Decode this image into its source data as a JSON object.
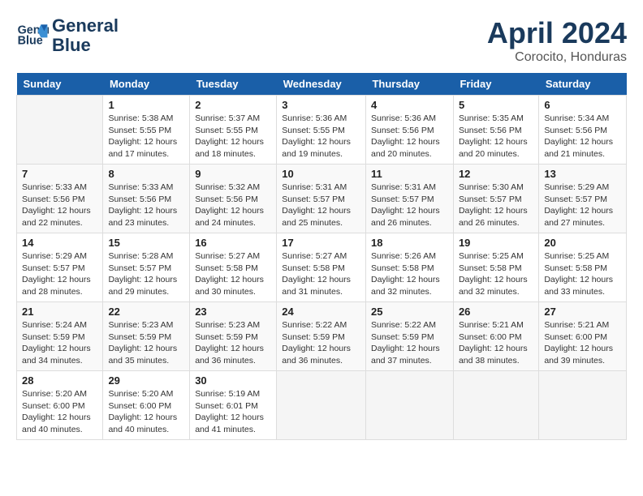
{
  "header": {
    "logo_line1": "General",
    "logo_line2": "Blue",
    "month": "April 2024",
    "location": "Corocito, Honduras"
  },
  "days_of_week": [
    "Sunday",
    "Monday",
    "Tuesday",
    "Wednesday",
    "Thursday",
    "Friday",
    "Saturday"
  ],
  "weeks": [
    [
      {
        "day": "",
        "info": ""
      },
      {
        "day": "1",
        "info": "Sunrise: 5:38 AM\nSunset: 5:55 PM\nDaylight: 12 hours\nand 17 minutes."
      },
      {
        "day": "2",
        "info": "Sunrise: 5:37 AM\nSunset: 5:55 PM\nDaylight: 12 hours\nand 18 minutes."
      },
      {
        "day": "3",
        "info": "Sunrise: 5:36 AM\nSunset: 5:55 PM\nDaylight: 12 hours\nand 19 minutes."
      },
      {
        "day": "4",
        "info": "Sunrise: 5:36 AM\nSunset: 5:56 PM\nDaylight: 12 hours\nand 20 minutes."
      },
      {
        "day": "5",
        "info": "Sunrise: 5:35 AM\nSunset: 5:56 PM\nDaylight: 12 hours\nand 20 minutes."
      },
      {
        "day": "6",
        "info": "Sunrise: 5:34 AM\nSunset: 5:56 PM\nDaylight: 12 hours\nand 21 minutes."
      }
    ],
    [
      {
        "day": "7",
        "info": "Sunrise: 5:33 AM\nSunset: 5:56 PM\nDaylight: 12 hours\nand 22 minutes."
      },
      {
        "day": "8",
        "info": "Sunrise: 5:33 AM\nSunset: 5:56 PM\nDaylight: 12 hours\nand 23 minutes."
      },
      {
        "day": "9",
        "info": "Sunrise: 5:32 AM\nSunset: 5:56 PM\nDaylight: 12 hours\nand 24 minutes."
      },
      {
        "day": "10",
        "info": "Sunrise: 5:31 AM\nSunset: 5:57 PM\nDaylight: 12 hours\nand 25 minutes."
      },
      {
        "day": "11",
        "info": "Sunrise: 5:31 AM\nSunset: 5:57 PM\nDaylight: 12 hours\nand 26 minutes."
      },
      {
        "day": "12",
        "info": "Sunrise: 5:30 AM\nSunset: 5:57 PM\nDaylight: 12 hours\nand 26 minutes."
      },
      {
        "day": "13",
        "info": "Sunrise: 5:29 AM\nSunset: 5:57 PM\nDaylight: 12 hours\nand 27 minutes."
      }
    ],
    [
      {
        "day": "14",
        "info": "Sunrise: 5:29 AM\nSunset: 5:57 PM\nDaylight: 12 hours\nand 28 minutes."
      },
      {
        "day": "15",
        "info": "Sunrise: 5:28 AM\nSunset: 5:57 PM\nDaylight: 12 hours\nand 29 minutes."
      },
      {
        "day": "16",
        "info": "Sunrise: 5:27 AM\nSunset: 5:58 PM\nDaylight: 12 hours\nand 30 minutes."
      },
      {
        "day": "17",
        "info": "Sunrise: 5:27 AM\nSunset: 5:58 PM\nDaylight: 12 hours\nand 31 minutes."
      },
      {
        "day": "18",
        "info": "Sunrise: 5:26 AM\nSunset: 5:58 PM\nDaylight: 12 hours\nand 32 minutes."
      },
      {
        "day": "19",
        "info": "Sunrise: 5:25 AM\nSunset: 5:58 PM\nDaylight: 12 hours\nand 32 minutes."
      },
      {
        "day": "20",
        "info": "Sunrise: 5:25 AM\nSunset: 5:58 PM\nDaylight: 12 hours\nand 33 minutes."
      }
    ],
    [
      {
        "day": "21",
        "info": "Sunrise: 5:24 AM\nSunset: 5:59 PM\nDaylight: 12 hours\nand 34 minutes."
      },
      {
        "day": "22",
        "info": "Sunrise: 5:23 AM\nSunset: 5:59 PM\nDaylight: 12 hours\nand 35 minutes."
      },
      {
        "day": "23",
        "info": "Sunrise: 5:23 AM\nSunset: 5:59 PM\nDaylight: 12 hours\nand 36 minutes."
      },
      {
        "day": "24",
        "info": "Sunrise: 5:22 AM\nSunset: 5:59 PM\nDaylight: 12 hours\nand 36 minutes."
      },
      {
        "day": "25",
        "info": "Sunrise: 5:22 AM\nSunset: 5:59 PM\nDaylight: 12 hours\nand 37 minutes."
      },
      {
        "day": "26",
        "info": "Sunrise: 5:21 AM\nSunset: 6:00 PM\nDaylight: 12 hours\nand 38 minutes."
      },
      {
        "day": "27",
        "info": "Sunrise: 5:21 AM\nSunset: 6:00 PM\nDaylight: 12 hours\nand 39 minutes."
      }
    ],
    [
      {
        "day": "28",
        "info": "Sunrise: 5:20 AM\nSunset: 6:00 PM\nDaylight: 12 hours\nand 40 minutes."
      },
      {
        "day": "29",
        "info": "Sunrise: 5:20 AM\nSunset: 6:00 PM\nDaylight: 12 hours\nand 40 minutes."
      },
      {
        "day": "30",
        "info": "Sunrise: 5:19 AM\nSunset: 6:01 PM\nDaylight: 12 hours\nand 41 minutes."
      },
      {
        "day": "",
        "info": ""
      },
      {
        "day": "",
        "info": ""
      },
      {
        "day": "",
        "info": ""
      },
      {
        "day": "",
        "info": ""
      }
    ]
  ]
}
